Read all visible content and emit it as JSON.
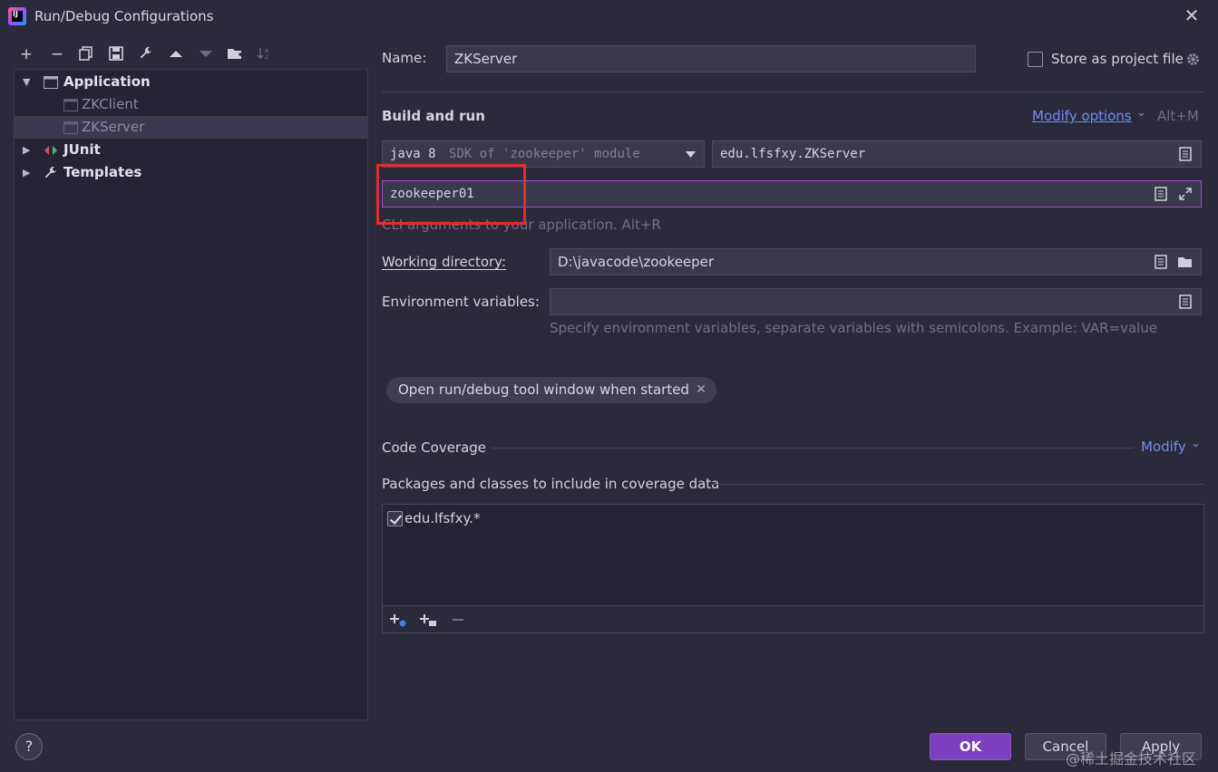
{
  "window": {
    "title": "Run/Debug Configurations",
    "app_icon_text": "IJ"
  },
  "tree": {
    "groups": [
      {
        "label": "Application",
        "expanded": true,
        "children": [
          "ZKClient",
          "ZKServer"
        ],
        "selected_child": "ZKServer"
      },
      {
        "label": "JUnit",
        "expanded": false
      },
      {
        "label": "Templates",
        "expanded": false
      }
    ]
  },
  "form": {
    "name_label": "Name:",
    "name_value": "ZKServer",
    "store_label": "Store as project file",
    "store_checked": false,
    "build_run_header": "Build and run",
    "modify_options_label": "Modify options",
    "modify_options_shortcut": "Alt+M",
    "sdk_java": "java 8",
    "sdk_desc": "SDK of 'zookeeper' module",
    "main_class": "edu.lfsfxy.ZKServer",
    "program_args": "zookeeper01",
    "program_args_hint": "CLI arguments to your application. Alt+R",
    "working_dir_label": "Working directory:",
    "working_dir_value": "D:\\javacode\\zookeeper",
    "env_label": "Environment variables:",
    "env_value": "",
    "env_hint": "Specify environment variables, separate variables with semicolons. Example: VAR=value",
    "chip_label": "Open run/debug tool window when started",
    "coverage_header": "Code Coverage",
    "coverage_modify": "Modify",
    "coverage_packages_label": "Packages and classes to include in coverage data",
    "coverage_entries": [
      {
        "pattern": "edu.lfsfxy.*",
        "checked": true
      }
    ]
  },
  "buttons": {
    "help": "?",
    "ok": "OK",
    "cancel": "Cancel",
    "apply": "Apply"
  },
  "watermark": "@稀土掘金技术社区",
  "colors": {
    "background": "#2b2a3a",
    "accent_link": "#6e8ff0",
    "primary_button": "#7b3fbf",
    "highlight_box": "#e32c2c",
    "focus_border": "#9b4fd6"
  }
}
